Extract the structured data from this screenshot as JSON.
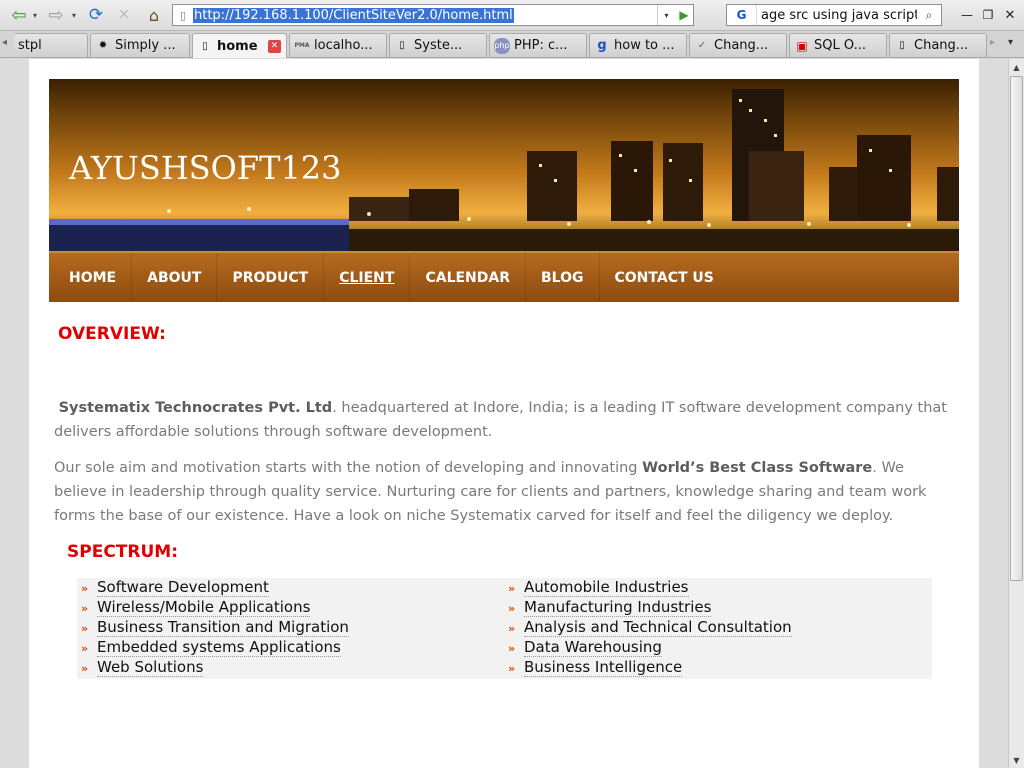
{
  "toolbar": {
    "back_glyph": "⇦",
    "forward_glyph": "⇨",
    "dropdown_glyph": "▾",
    "reload_glyph": "⟳",
    "stop_glyph": "✕",
    "home_glyph": "⌂",
    "url": "http://192.168.1.100/ClientSiteVer2.0/home.html",
    "go_glyph": "▶",
    "search_engine": "G",
    "search_text": "age src using java script",
    "search_glyph": "⌕",
    "minimize_glyph": "—",
    "maximize_glyph": "❐",
    "close_glyph": "✕"
  },
  "tabs": [
    {
      "label": "stpl",
      "icon": "none"
    },
    {
      "label": "Simply ...",
      "icon": "gear-icon"
    },
    {
      "label": "home",
      "icon": "page-icon",
      "active": true
    },
    {
      "label": "localho...",
      "icon": "pma-icon"
    },
    {
      "label": "Syste...",
      "icon": "page-icon"
    },
    {
      "label": "PHP: c...",
      "icon": "php-icon"
    },
    {
      "label": "how to ...",
      "icon": "google-icon"
    },
    {
      "label": "Chang...",
      "icon": "leaf-icon"
    },
    {
      "label": "SQL O...",
      "icon": "dice-icon"
    },
    {
      "label": "Chang...",
      "icon": "page-icon"
    }
  ],
  "tab_icon_glyphs": {
    "gear": "✹",
    "page": "▯",
    "pma": "PMA",
    "php": "php",
    "google": "g",
    "leaf": "✓",
    "dice": "▣"
  },
  "site": {
    "title": "AYUSHSOFT123",
    "nav": [
      "HOME",
      "ABOUT",
      "PRODUCT",
      "CLIENT",
      "CALENDAR",
      "BLOG",
      "CONTACT US"
    ],
    "current_nav": "CLIENT",
    "overview_heading": "OVERVIEW:",
    "p1_company": "Systematix Technocrates Pvt. Ltd",
    "p1_rest": ". headquartered at Indore, India; is a leading IT software development company that delivers affordable solutions through software development.",
    "p2_start": "Our sole aim and motivation starts with the notion of developing and innovating ",
    "p2_bold": "World’s Best Class Software",
    "p2_rest": ". We believe in leadership through quality service. Nurturing care for clients and partners, knowledge sharing and team work forms the base of our existence. Have a look on niche Systematix carved for itself and feel the diligency we deploy.",
    "spectrum_heading": "SPECTRUM:",
    "bullet": "»",
    "spectrum_left": [
      "Software Development",
      "Wireless/Mobile Applications",
      "Business Transition and Migration",
      "Embedded systems Applications",
      "Web Solutions"
    ],
    "spectrum_right": [
      "Automobile Industries",
      "Manufacturing Industries",
      "Analysis and Technical Consultation",
      "Data Warehousing",
      "Business Intelligence"
    ]
  },
  "colors": {
    "heading_red": "#e00000",
    "nav_brown": "#8e4c10",
    "bullet_orange": "#d24e00"
  }
}
